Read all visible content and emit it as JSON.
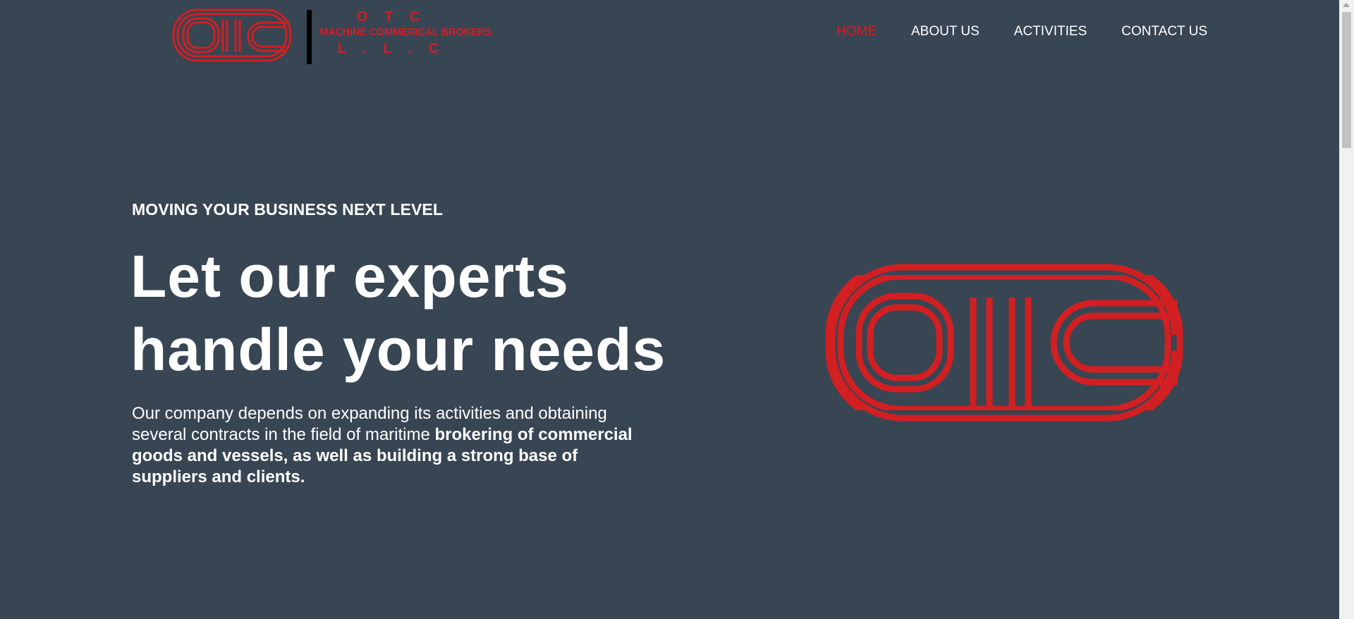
{
  "header": {
    "logo": {
      "mark_text": "OTC",
      "line1": "O T C",
      "line2": "MACHINE COMMERICAL BROKERS",
      "line3": "L . L . C"
    },
    "nav": [
      {
        "label": "HOME",
        "active": true
      },
      {
        "label": "ABOUT US",
        "active": false
      },
      {
        "label": "ACTIVITIES",
        "active": false
      },
      {
        "label": "CONTACT US",
        "active": false
      }
    ]
  },
  "hero": {
    "eyebrow": "MOVING YOUR BUSINESS NEXT LEVEL",
    "headline_line1": "Let our experts",
    "headline_line2": "handle your needs",
    "body_plain": "Our company depends on expanding its activities and obtaining several contracts in the field of maritime ",
    "body_bold": "brokering of commercial goods and vessels, as well as building a strong base of suppliers and clients."
  },
  "colors": {
    "background": "#384553",
    "brand_red": "#d21f22",
    "text": "#ffffff"
  }
}
